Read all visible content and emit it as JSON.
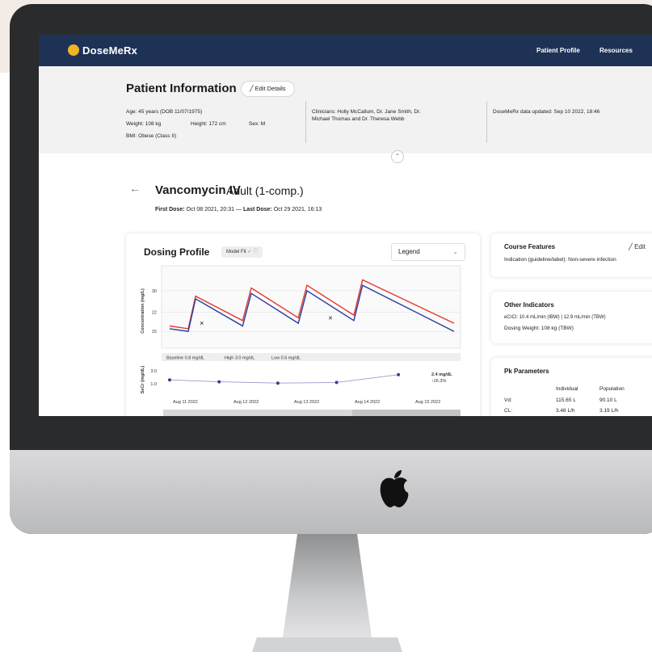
{
  "nav": {
    "brand": "DoseMeRx",
    "links": [
      "Patient Profile",
      "Resources"
    ]
  },
  "patient": {
    "title": "Patient Information",
    "edit_label": "Edit Details",
    "age": "Age: 45 years (DOB 11/07/1975)",
    "weight": "Weight: 108 kg",
    "height": "Height: 172 cm",
    "sex": "Sex: M",
    "bmi": "BMI: Obese (Class II)",
    "clinicians_line1": "Clinicians: Holly McCallum, Dr. Jane Smith, Dr.",
    "clinicians_line2": "Michael Thomas and Dr. Theresa Webb",
    "updated": "DoseMeRx data updated: Sep 10 2022, 18:46"
  },
  "drug": {
    "name": "Vancomycin IV",
    "subtitle": "Adult (1-comp.)",
    "first_dose_label": "First Dose:",
    "first_dose": "Oct 08 2021, 20:31",
    "separator": "—",
    "last_dose_label": "Last Dose:",
    "last_dose": "Oct 29 2021, 16:13"
  },
  "dosing_profile": {
    "title": "Dosing Profile",
    "model_fit": "Model Fit",
    "legend_label": "Legend",
    "scr_baseline": "Baseline 0.8 mg/dL",
    "scr_high": "High 3.0 mg/dL",
    "scr_low": "Low 0.6 mg/dL",
    "scr_last_value": "2.4 mg/dL",
    "scr_change": "↑26.3%"
  },
  "chart_data": {
    "type": "line",
    "ylabel": "Concentration (mg/L)",
    "yticks": [
      15,
      22,
      30
    ],
    "ylim": [
      10,
      38
    ],
    "x_tick_labels": [
      "Aug 11 2022",
      "Aug 12 2022",
      "Aug 13 2022",
      "Aug 14 2022",
      "Aug 15 2022"
    ],
    "xlim": [
      0,
      4.6
    ],
    "series": [
      {
        "color": "#e03a2e",
        "x": [
          0,
          0.3,
          0.42,
          1.18,
          1.32,
          2.08,
          2.22,
          2.98,
          3.12,
          4.6
        ],
        "y": [
          17,
          16,
          28,
          19,
          31,
          20,
          32,
          21,
          34,
          18
        ]
      },
      {
        "color": "#2b3a9e",
        "x": [
          0,
          0.3,
          0.42,
          1.18,
          1.32,
          2.08,
          2.22,
          2.98,
          3.12,
          4.6
        ],
        "y": [
          16,
          15,
          27,
          17,
          29,
          18,
          30,
          19,
          32,
          15
        ]
      }
    ],
    "observations": [
      {
        "x": 0.52,
        "y": 18
      },
      {
        "x": 2.6,
        "y": 20
      }
    ],
    "scr": {
      "ylabel": "SeCr (mg/dL)",
      "yticks": [
        1.0,
        3.0
      ],
      "ylim": [
        0,
        4
      ],
      "x": [
        0,
        0.8,
        1.75,
        2.7,
        3.7
      ],
      "y": [
        1.6,
        1.3,
        1.1,
        1.2,
        2.4
      ]
    }
  },
  "course_features": {
    "title": "Course Features",
    "edit_label": "Edit",
    "indication": "Indication (guideline/label): Non-severe infection"
  },
  "other_indicators": {
    "title": "Other Indicators",
    "ecrcl": "eCrCl: 10.4 mL/min (IBW)  |  12.9 mL/min (TBW)",
    "dosing_weight": "Dosing Weight: 108 kg (TBW)"
  },
  "pk": {
    "title": "Pk Parameters",
    "columns": [
      "",
      "Individual",
      "Population"
    ],
    "rows": [
      [
        "Vd:",
        "115.65 L",
        "90.10 L"
      ],
      [
        "CL:",
        "3.48 L/h",
        "3.19 L/h"
      ]
    ]
  }
}
